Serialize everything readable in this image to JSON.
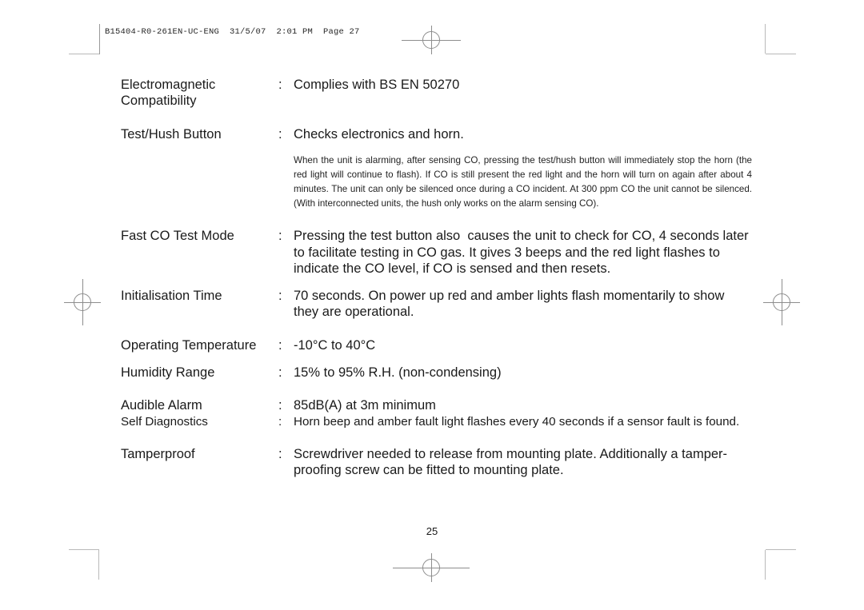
{
  "document": {
    "file_slug": "B15404-R0-261EN-UC-ENG  31/5/07  2:01 PM  Page 27",
    "folio": "25",
    "colon": ":"
  },
  "spec_rows": [
    {
      "label": "Electromagnetic\nCompatibility",
      "value": "Complies with BS EN 50270"
    },
    {
      "label": "Test/Hush Button",
      "value": "Checks electronics and horn."
    },
    {
      "label": "Fast CO Test Mode",
      "value": "Pressing the test button also  causes the unit to check for CO, 4 seconds later to facilitate testing in CO gas. It gives 3 beeps and the red light flashes to indicate the CO level, if CO is sensed and then resets."
    },
    {
      "label": "Initialisation Time",
      "value": "70 seconds. On power up red and amber lights flash momentarily to show they are operational."
    },
    {
      "label": "Operating\nTemperature",
      "value": "-10°C to 40°C"
    },
    {
      "label": "Humidity Range",
      "value": "15% to 95% R.H. (non-condensing)"
    },
    {
      "label": "Audible Alarm",
      "value": "85dB(A) at 3m minimum"
    },
    {
      "label": "Self Diagnostics",
      "value": "Horn beep and amber fault light flashes every 40 seconds if a sensor fault is found."
    },
    {
      "label": "Tamperproof",
      "value": "Screwdriver needed to release from mounting plate. Additionally a tamper-proofing screw can be fitted to mounting plate."
    }
  ],
  "hush_note": "When the unit is alarming, after sensing CO, pressing the test/hush button will immediately stop the horn (the red light will continue to flash). If CO is still present the red light and the horn will turn on again after about 4 minutes. The unit can only be silenced once during a CO incident. At 300 ppm CO the unit cannot be silenced.  (With interconnected units, the hush only works on the alarm sensing CO)."
}
